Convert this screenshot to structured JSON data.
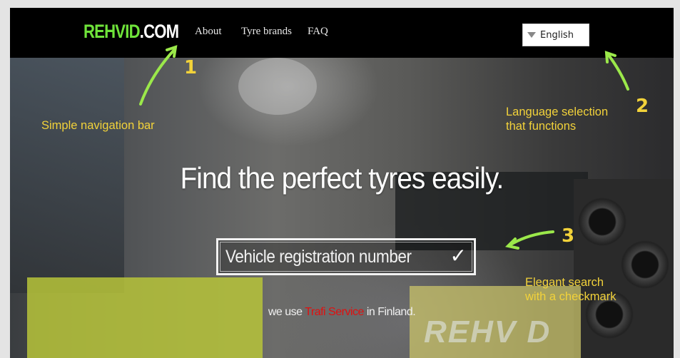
{
  "nav": {
    "logo_a": "REHVID",
    "logo_b": ".COM",
    "links": [
      "About",
      "Tyre brands",
      "FAQ"
    ],
    "language": "English"
  },
  "hero": {
    "headline": "Find the perfect tyres easily.",
    "search_placeholder": "Vehicle registration number",
    "check": "✓",
    "footnote_pre": "we use ",
    "footnote_brand": "Trafi Service",
    "footnote_post": " in Finland.",
    "sign_text": "REHV D"
  },
  "annotations": {
    "a1": "Simple navigation bar",
    "a2_line1": "Language selection",
    "a2_line2": "that functions",
    "a3_line1": "Elegant search",
    "a3_line2": "with a checkmark",
    "n1": "1",
    "n2": "2",
    "n3": "3"
  },
  "colors": {
    "annotation": "#f2d23a",
    "arrow": "#9be84a",
    "logo_green": "#6fe33a",
    "footnote_red": "#e01010"
  }
}
